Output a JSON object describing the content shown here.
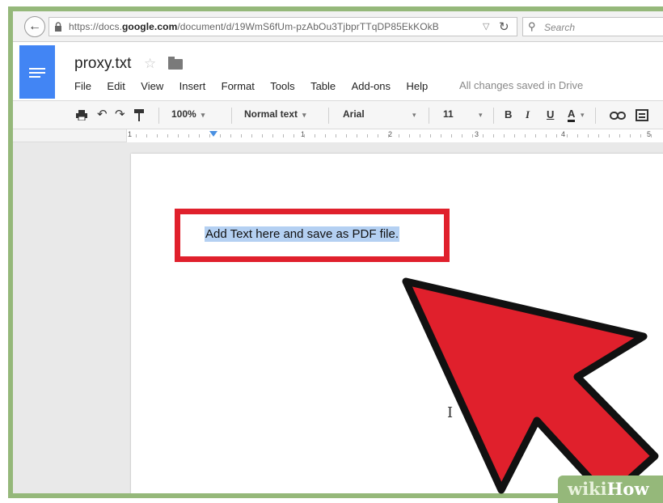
{
  "browser": {
    "url_prefix": "https://docs.",
    "url_domain": "google.com",
    "url_path": "/document/d/19WmS6fUm-pzAbOu3TjbprTTqDP85EkKOkB",
    "search_placeholder": "Search"
  },
  "docs": {
    "title": "proxy.txt",
    "menu": [
      "File",
      "Edit",
      "View",
      "Insert",
      "Format",
      "Tools",
      "Table",
      "Add-ons",
      "Help"
    ],
    "save_status": "All changes saved in Drive"
  },
  "toolbar": {
    "zoom": "100%",
    "style": "Normal text",
    "font": "Arial",
    "size": "11",
    "bold": "B",
    "italic": "I",
    "underline": "U",
    "text_color": "A"
  },
  "ruler": {
    "numbers": [
      "1",
      "1",
      "2",
      "3",
      "4",
      "5"
    ]
  },
  "document": {
    "text": "Add Text here and save as PDF file."
  },
  "watermark": {
    "part1": "wiki",
    "part2": "How"
  },
  "colors": {
    "accent_red": "#e0202c",
    "docs_blue": "#4285f4",
    "selection": "#b4d0f2",
    "frame_green": "#95b87a"
  }
}
